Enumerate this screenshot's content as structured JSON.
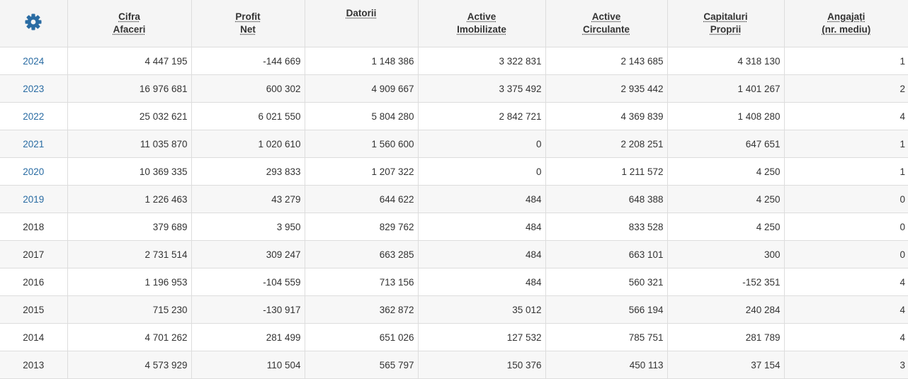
{
  "colors": {
    "accent": "#2a6ca3",
    "header_bg": "#f5f5f5",
    "row_alt_bg": "#f7f7f7",
    "border": "#dddddd"
  },
  "settings_icon": "gear-icon",
  "headers": [
    {
      "line1": "Cifra",
      "line2": "Afaceri"
    },
    {
      "line1": "Profit",
      "line2": "Net"
    },
    {
      "line1": "Datorii",
      "line2": ""
    },
    {
      "line1": "Active",
      "line2": "Imobilizate"
    },
    {
      "line1": "Active",
      "line2": "Circulante"
    },
    {
      "line1": "Capitaluri",
      "line2": "Proprii"
    },
    {
      "line1": "Angajați",
      "line2": "(nr. mediu)"
    }
  ],
  "rows": [
    {
      "year": "2024",
      "linked": true,
      "cifra_afaceri": "4 447 195",
      "profit_net": "-144 669",
      "datorii": "1 148 386",
      "active_imobilizate": "3 322 831",
      "active_circulante": "2 143 685",
      "capitaluri_proprii": "4 318 130",
      "angajati": "1"
    },
    {
      "year": "2023",
      "linked": true,
      "cifra_afaceri": "16 976 681",
      "profit_net": "600 302",
      "datorii": "4 909 667",
      "active_imobilizate": "3 375 492",
      "active_circulante": "2 935 442",
      "capitaluri_proprii": "1 401 267",
      "angajati": "2"
    },
    {
      "year": "2022",
      "linked": true,
      "cifra_afaceri": "25 032 621",
      "profit_net": "6 021 550",
      "datorii": "5 804 280",
      "active_imobilizate": "2 842 721",
      "active_circulante": "4 369 839",
      "capitaluri_proprii": "1 408 280",
      "angajati": "4"
    },
    {
      "year": "2021",
      "linked": true,
      "cifra_afaceri": "11 035 870",
      "profit_net": "1 020 610",
      "datorii": "1 560 600",
      "active_imobilizate": "0",
      "active_circulante": "2 208 251",
      "capitaluri_proprii": "647 651",
      "angajati": "1"
    },
    {
      "year": "2020",
      "linked": true,
      "cifra_afaceri": "10 369 335",
      "profit_net": "293 833",
      "datorii": "1 207 322",
      "active_imobilizate": "0",
      "active_circulante": "1 211 572",
      "capitaluri_proprii": "4 250",
      "angajati": "1"
    },
    {
      "year": "2019",
      "linked": true,
      "cifra_afaceri": "1 226 463",
      "profit_net": "43 279",
      "datorii": "644 622",
      "active_imobilizate": "484",
      "active_circulante": "648 388",
      "capitaluri_proprii": "4 250",
      "angajati": "0"
    },
    {
      "year": "2018",
      "linked": false,
      "cifra_afaceri": "379 689",
      "profit_net": "3 950",
      "datorii": "829 762",
      "active_imobilizate": "484",
      "active_circulante": "833 528",
      "capitaluri_proprii": "4 250",
      "angajati": "0"
    },
    {
      "year": "2017",
      "linked": false,
      "cifra_afaceri": "2 731 514",
      "profit_net": "309 247",
      "datorii": "663 285",
      "active_imobilizate": "484",
      "active_circulante": "663 101",
      "capitaluri_proprii": "300",
      "angajati": "0"
    },
    {
      "year": "2016",
      "linked": false,
      "cifra_afaceri": "1 196 953",
      "profit_net": "-104 559",
      "datorii": "713 156",
      "active_imobilizate": "484",
      "active_circulante": "560 321",
      "capitaluri_proprii": "-152 351",
      "angajati": "4"
    },
    {
      "year": "2015",
      "linked": false,
      "cifra_afaceri": "715 230",
      "profit_net": "-130 917",
      "datorii": "362 872",
      "active_imobilizate": "35 012",
      "active_circulante": "566 194",
      "capitaluri_proprii": "240 284",
      "angajati": "4"
    },
    {
      "year": "2014",
      "linked": false,
      "cifra_afaceri": "4 701 262",
      "profit_net": "281 499",
      "datorii": "651 026",
      "active_imobilizate": "127 532",
      "active_circulante": "785 751",
      "capitaluri_proprii": "281 789",
      "angajati": "4"
    },
    {
      "year": "2013",
      "linked": false,
      "cifra_afaceri": "4 573 929",
      "profit_net": "110 504",
      "datorii": "565 797",
      "active_imobilizate": "150 376",
      "active_circulante": "450 113",
      "capitaluri_proprii": "37 154",
      "angajati": "3"
    }
  ]
}
